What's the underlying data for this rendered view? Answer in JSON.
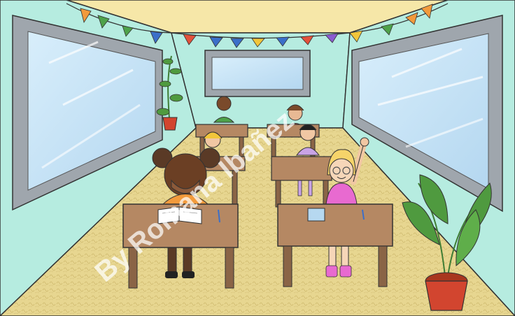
{
  "scene": {
    "description_label": "Cartoon illustration of a classroom with children at desks",
    "colors": {
      "wall": "#b6ece0",
      "ceiling": "#f6e7a8",
      "floor": "#e7d690",
      "window_frame": "#9fa6ad",
      "window_glass": "#c6e3f6",
      "desk": "#b58863",
      "desk_dark": "#8a6446",
      "plant_leaf": "#4f9a3f",
      "pot": "#d2452f"
    },
    "bunting_colors": [
      "#f29a3b",
      "#4ea24a",
      "#3b6fc9",
      "#f2c63b",
      "#e3513b",
      "#8b5bd1"
    ],
    "watermark": {
      "text": "By Romana Ibañez",
      "color": "#ffffff"
    }
  }
}
